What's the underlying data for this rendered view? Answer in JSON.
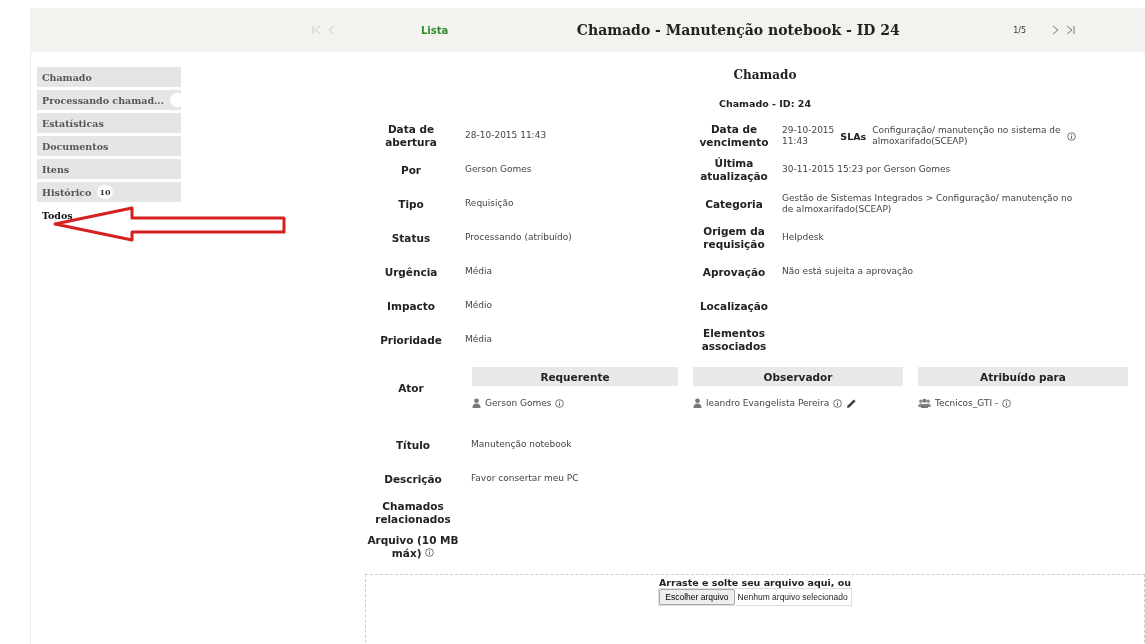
{
  "header": {
    "nav": [
      {
        "kind": "first",
        "disabled": true
      },
      {
        "kind": "prev",
        "disabled": true
      }
    ],
    "list_link": "Lista",
    "title": "Chamado - Manutenção notebook - ID 24",
    "counter": "1/5",
    "nav_right": [
      {
        "kind": "next",
        "disabled": false
      },
      {
        "kind": "last",
        "disabled": false
      }
    ]
  },
  "sidebar": {
    "tabs": [
      {
        "label": "Chamado",
        "selected": false
      },
      {
        "label": "Processando chamad...",
        "selected": false,
        "badge_clipped": true
      },
      {
        "label": "Estatísticas",
        "selected": false
      },
      {
        "label": "Documentos",
        "selected": false
      },
      {
        "label": "Itens",
        "selected": false
      },
      {
        "label": "Histórico",
        "selected": false,
        "badge": "10"
      },
      {
        "label": "Todos",
        "selected": true
      }
    ]
  },
  "form": {
    "heading": "Chamado",
    "subheading": "Chamado - ID: 24",
    "rows": [
      {
        "left": {
          "label": "Data de\nabertura",
          "value": "28-10-2015 11:43"
        },
        "right": {
          "label": "Data de\nvencimento",
          "value": "29-10-2015\n11:43",
          "sla_label": "SLAs",
          "sla_value": "Configuração/ manutenção no sistema de\nalmoxarifado(SCEAP)"
        }
      },
      {
        "left": {
          "label": "Por",
          "value": "Gerson Gomes"
        },
        "right": {
          "label": "Última\natualização",
          "value": "30-11-2015 15:23 por Gerson Gomes"
        }
      },
      {
        "left": {
          "label": "Tipo",
          "value": "Requisição"
        },
        "right": {
          "label": "Categoria",
          "value": "Gestão de Sistemas Integrados > Configuração/ manutenção no\nde almoxarifado(SCEAP)"
        }
      },
      {
        "left": {
          "label": "Status",
          "value": "Processando (atribuído)"
        },
        "right": {
          "label": "Origem da\nrequisição",
          "value": "Helpdesk"
        }
      },
      {
        "left": {
          "label": "Urgência",
          "value": "Média"
        },
        "right": {
          "label": "Aprovação",
          "value": "Não está sujeita a aprovação"
        }
      },
      {
        "left": {
          "label": "Impacto",
          "value": "Médio"
        },
        "right": {
          "label": "Localização"
        }
      },
      {
        "left": {
          "label": "Prioridade",
          "value": "Média"
        },
        "right": {
          "label": "Elementos\nassociados"
        }
      }
    ],
    "actors": {
      "label": "Ator",
      "columns": [
        {
          "heading": "Requerente",
          "entries": [
            {
              "kind": "user",
              "name": "Gerson Gomes",
              "editable": false
            }
          ]
        },
        {
          "heading": "Observador",
          "entries": [
            {
              "kind": "user",
              "name": "leandro Evangelista Pereira",
              "editable": true
            }
          ]
        },
        {
          "heading": "Atribuído para",
          "entries": [
            {
              "kind": "group",
              "name": "Tecnicos_GTI -",
              "editable": false
            }
          ]
        }
      ]
    },
    "details": [
      {
        "label": "Título",
        "value": "Manutenção notebook"
      },
      {
        "label": "Descrição",
        "value": "Favor consertar meu PC"
      },
      {
        "label": "Chamados\nrelacionados"
      },
      {
        "label": "Arquivo (10 MB\nmáx)",
        "info": true
      }
    ],
    "dropzone": {
      "prompt": "Arraste e solte seu arquivo aqui, ou",
      "button": "Escolher arquivo",
      "status": "Nenhum arquivo selecionado"
    }
  }
}
